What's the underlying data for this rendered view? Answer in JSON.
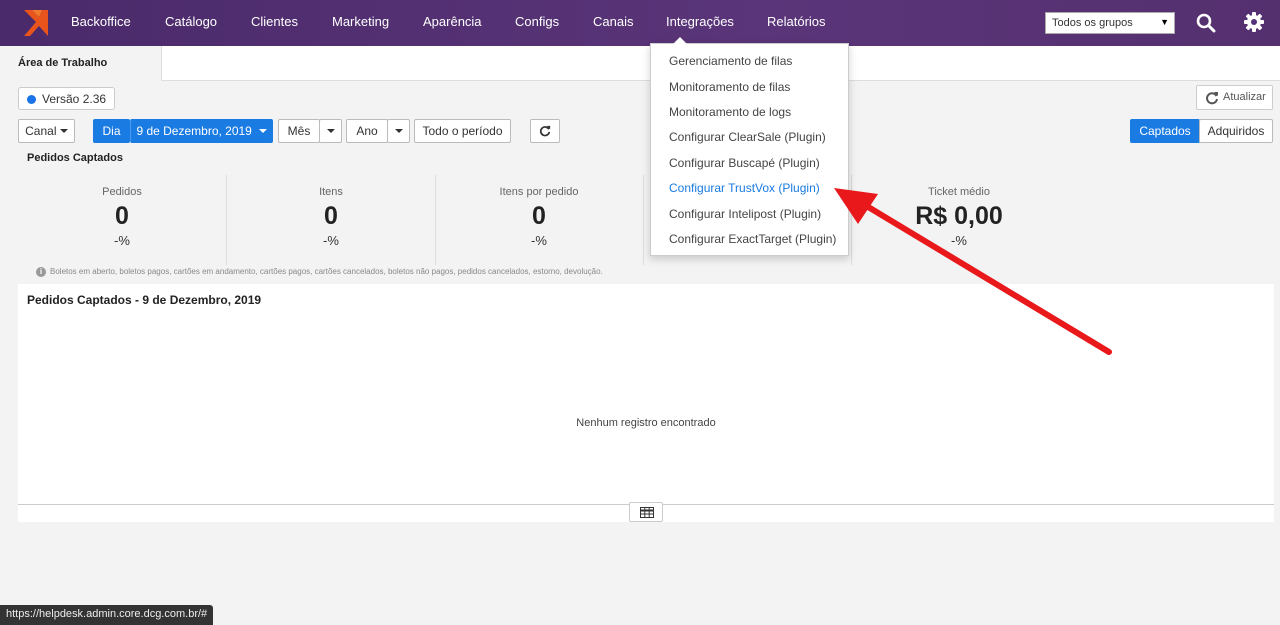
{
  "nav": {
    "items": [
      "Backoffice",
      "Catálogo",
      "Clientes",
      "Marketing",
      "Aparência",
      "Configs",
      "Canais",
      "Integrações",
      "Relatórios"
    ],
    "group_select": "Todos os grupos"
  },
  "tabs": {
    "active": "Área de Trabalho"
  },
  "version": "Versão 2.36",
  "toolbar": {
    "refresh": "Atualizar",
    "canal": "Canal",
    "dia": "Dia",
    "date": "9 de Dezembro, 2019",
    "mes": "Mês",
    "ano": "Ano",
    "todo": "Todo o período",
    "captados": "Captados",
    "adquiridos": "Adquiridos"
  },
  "summary": {
    "title": "Pedidos Captados",
    "stats": [
      {
        "label": "Pedidos",
        "value": "0",
        "pct": "-%"
      },
      {
        "label": "Itens",
        "value": "0",
        "pct": "-%"
      },
      {
        "label": "Itens por pedido",
        "value": "0",
        "pct": "-%"
      },
      {
        "label": "Ticket médio",
        "value": "R$ 0,00",
        "pct": "-%"
      }
    ],
    "note": "Boletos em aberto, boletos pagos, cartões em andamento, cartões pagos, cartões cancelados, boletos não pagos, pedidos cancelados, estorno, devolução."
  },
  "panel": {
    "title": "Pedidos Captados - 9 de Dezembro, 2019",
    "empty": "Nenhum registro encontrado"
  },
  "dropdown": {
    "items": [
      "Gerenciamento de filas",
      "Monitoramento de filas",
      "Monitoramento de logs",
      "Configurar ClearSale (Plugin)",
      "Configurar Buscapé (Plugin)",
      "Configurar TrustVox (Plugin)",
      "Configurar Intelipost (Plugin)",
      "Configurar ExactTarget (Plugin)"
    ],
    "highlighted_index": 5
  },
  "status_url": "https://helpdesk.admin.core.dcg.com.br/#",
  "colors": {
    "topbar": "#56307a",
    "accent": "#1a7be2",
    "arrow": "#e8181b"
  }
}
